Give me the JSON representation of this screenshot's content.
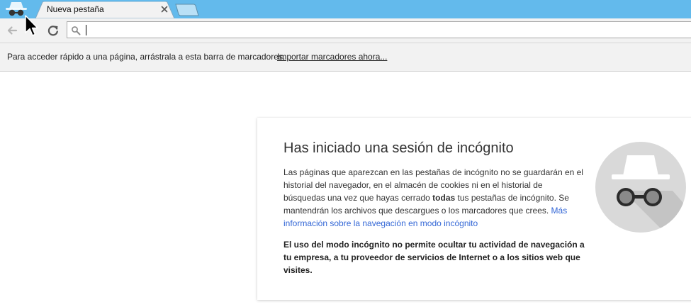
{
  "colors": {
    "tabstrip": "#63baec",
    "toolbar": "#f2f2f2",
    "link": "#3367d6",
    "incognito_circle": "#d9d9d9"
  },
  "tab": {
    "title": "Nueva pestaña",
    "close_icon": "close-icon"
  },
  "toolbar": {
    "back_icon": "back-arrow-icon",
    "reload_icon": "reload-icon",
    "omnibox_value": "",
    "omnibox_icon": "search-icon"
  },
  "bookmarks": {
    "hint": "Para acceder rápido a una página, arrástrala a esta barra de marcadores.",
    "import_link": "Importar marcadores ahora..."
  },
  "incognito": {
    "title": "Has iniciado una sesión de incógnito",
    "p1_before": "Las páginas que aparezcan en las pestañas de incógnito no se guardarán en el historial del navegador, en el almacén de cookies ni en el historial de búsquedas una vez que hayas cerrado ",
    "p1_bold": "todas",
    "p1_after": " tus pestañas de incógnito. Se mantendrán los archivos que descargues o los marcadores que crees. ",
    "p1_link": "Más información sobre la navegación en modo incógnito",
    "warning": "El uso del modo incógnito no permite ocultar tu actividad de navegación a tu empresa, a tu proveedor de servicios de Internet o a los sitios web que visites."
  }
}
